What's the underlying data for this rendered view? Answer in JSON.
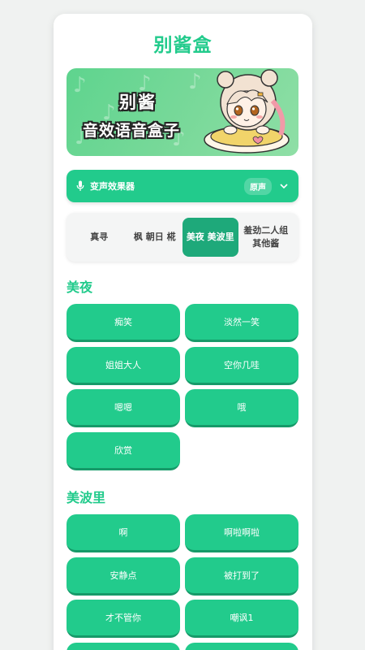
{
  "app": {
    "title": "别酱盒"
  },
  "banner": {
    "line1": "别酱",
    "line2": "音效语音盒子"
  },
  "voice_changer": {
    "label": "变声效果器",
    "value": "原声"
  },
  "tabs": [
    {
      "label": "真寻",
      "active": false
    },
    {
      "label": "枫 朝日 椛",
      "active": false
    },
    {
      "label": "美夜 美波里",
      "active": true
    },
    {
      "label": "羞劲二人组 其他酱",
      "active": false
    }
  ],
  "sections": [
    {
      "title": "美夜",
      "buttons": [
        "痴笑",
        "淡然一笑",
        "姐姐大人",
        "空你几哇",
        "嗯嗯",
        "哦",
        "欣赏"
      ]
    },
    {
      "title": "美波里",
      "buttons": [
        "啊",
        "啊啦啊啦",
        "安静点",
        "被打到了",
        "才不管你",
        "嘲讽1"
      ]
    }
  ],
  "colors": {
    "accent": "#22cb8c",
    "accent_dark": "#1ea97a",
    "background": "#f0f2f1"
  }
}
